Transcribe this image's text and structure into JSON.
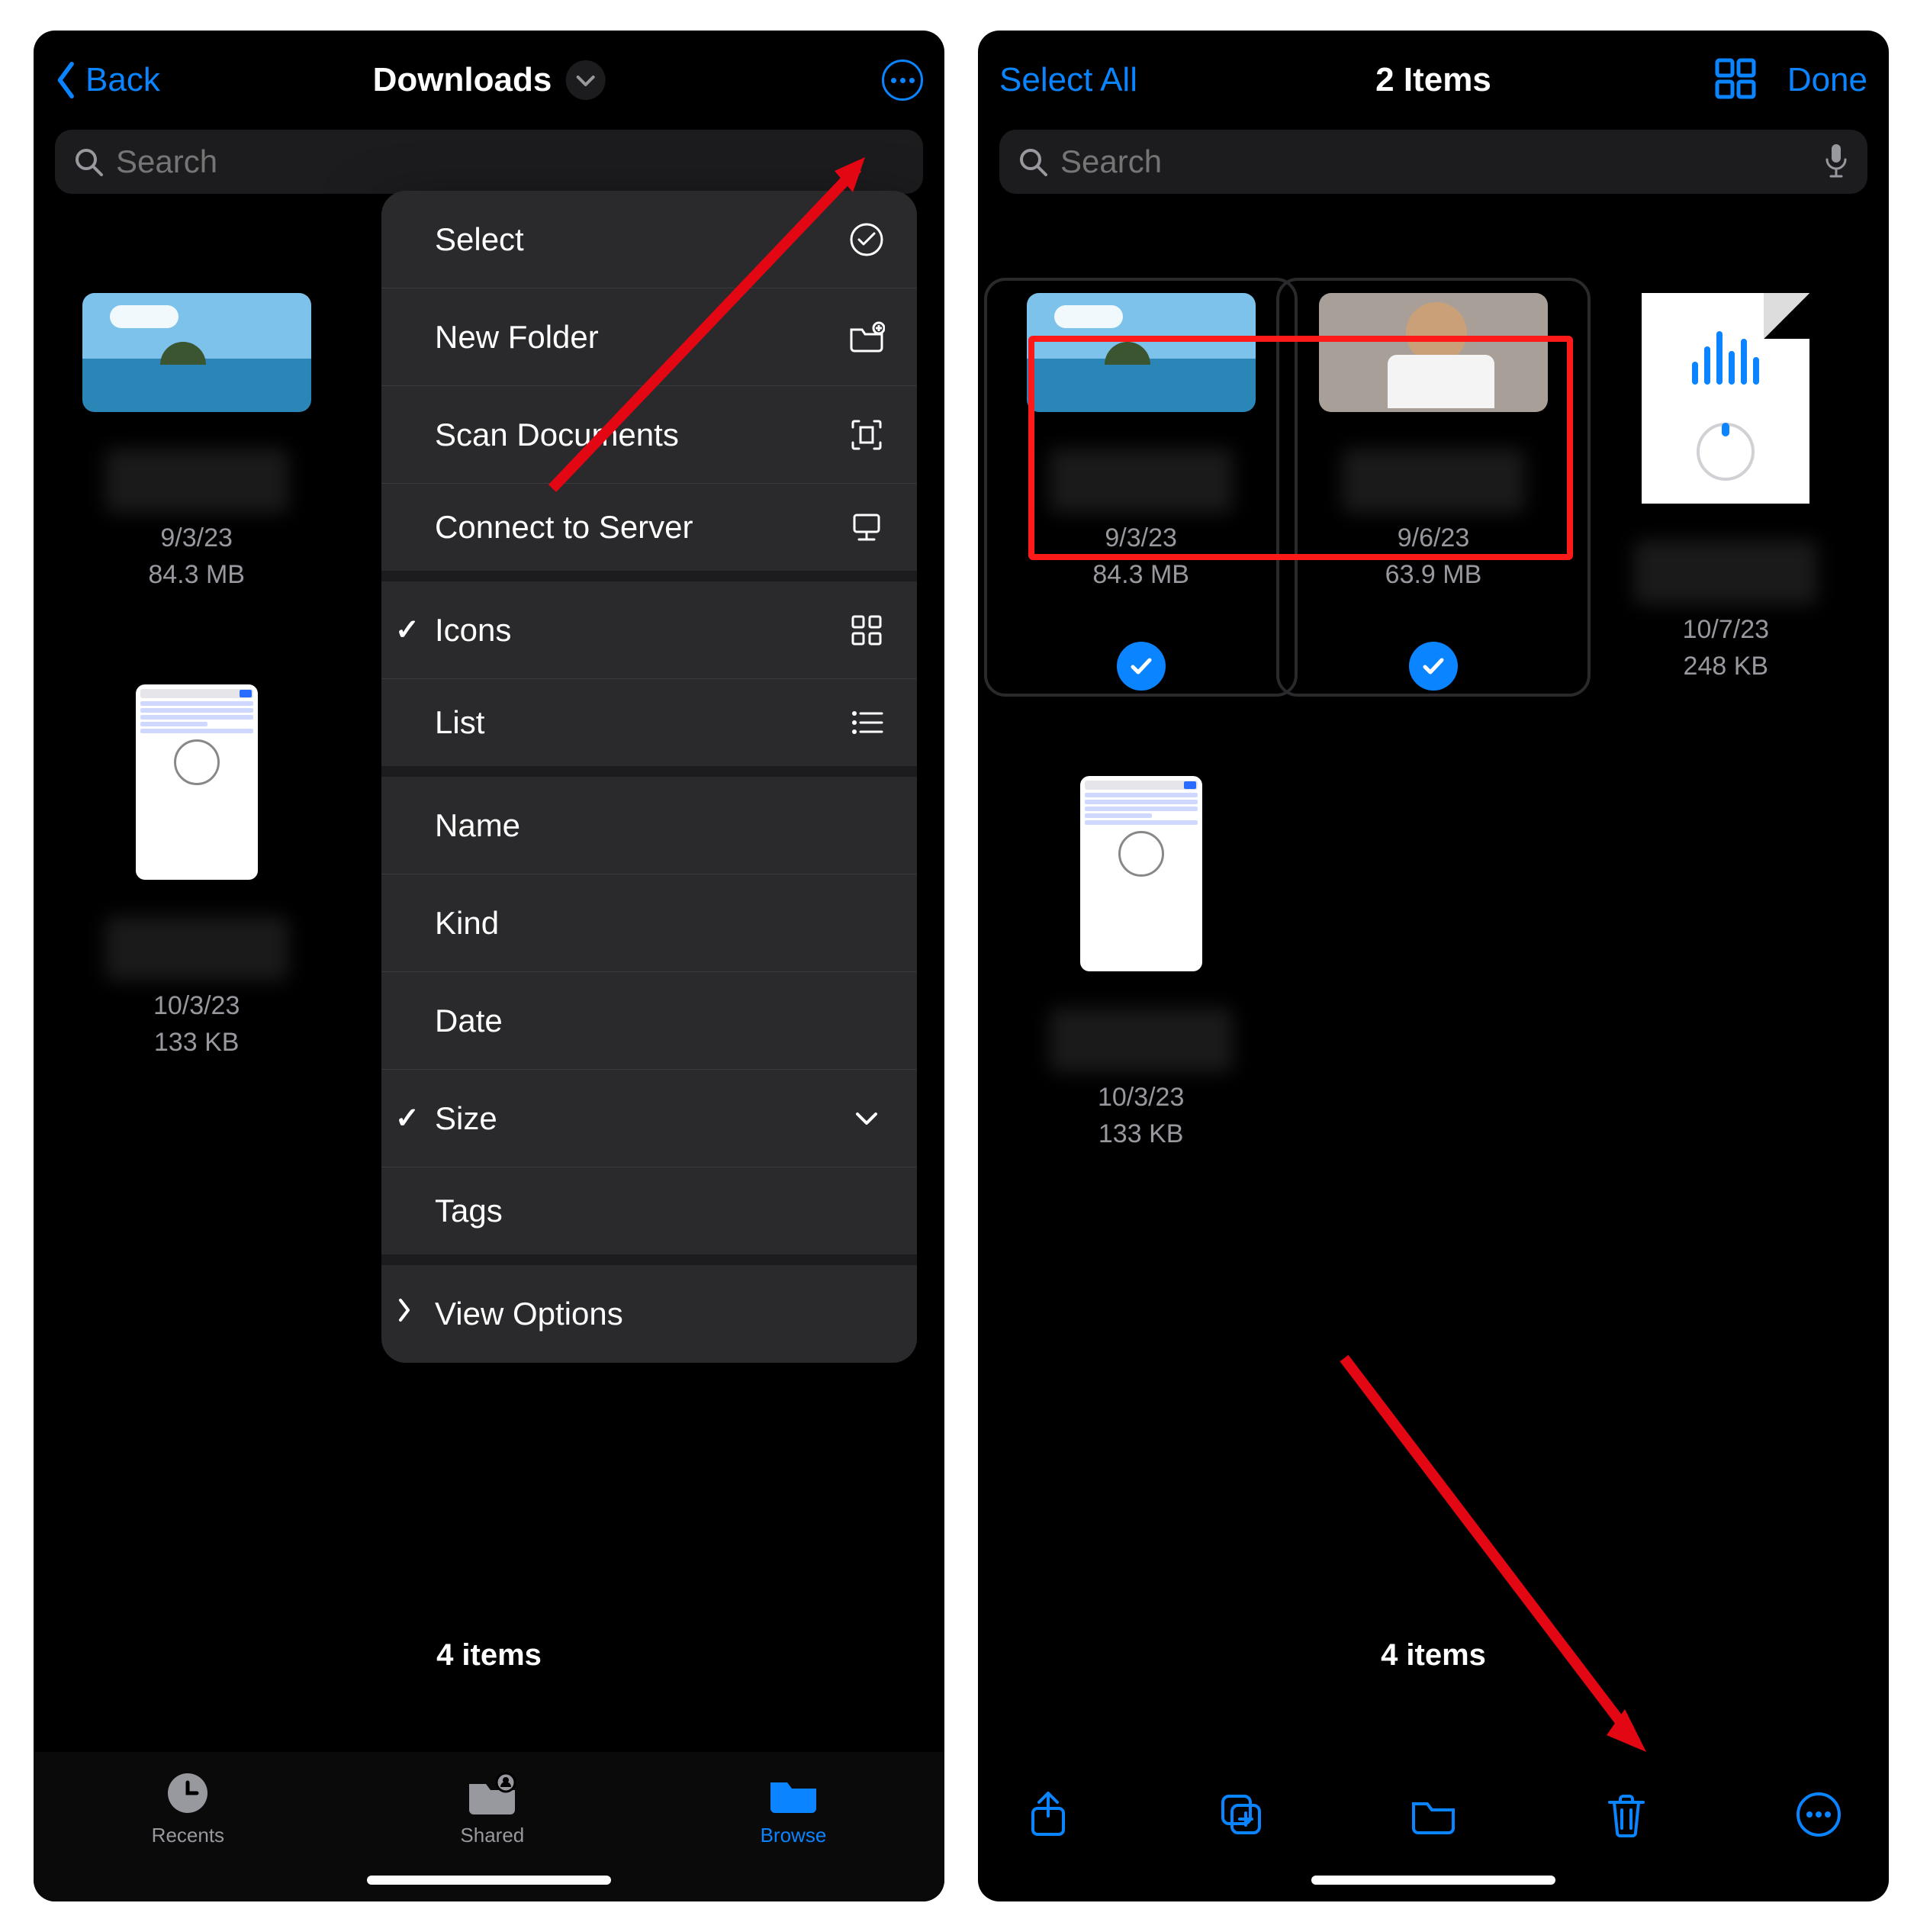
{
  "left": {
    "header": {
      "back": "Back",
      "title": "Downloads"
    },
    "search_placeholder": "Search",
    "files": [
      {
        "date": "9/3/23",
        "size": "84.3 MB"
      },
      {
        "date": "10/3/23",
        "size": "133 KB"
      }
    ],
    "menu": {
      "select": "Select",
      "new_folder": "New Folder",
      "scan_documents": "Scan Documents",
      "connect_to_server": "Connect to Server",
      "icons": "Icons",
      "list": "List",
      "name": "Name",
      "kind": "Kind",
      "date": "Date",
      "size": "Size",
      "tags": "Tags",
      "view_options": "View Options"
    },
    "footer_count": "4 items",
    "tabs": {
      "recents": "Recents",
      "shared": "Shared",
      "browse": "Browse"
    }
  },
  "right": {
    "header": {
      "select_all": "Select All",
      "title": "2 Items",
      "done": "Done"
    },
    "search_placeholder": "Search",
    "files": [
      {
        "date": "9/3/23",
        "size": "84.3 MB",
        "selected": true,
        "kind": "video"
      },
      {
        "date": "9/6/23",
        "size": "63.9 MB",
        "selected": true,
        "kind": "video"
      },
      {
        "date": "10/7/23",
        "size": "248 KB",
        "selected": false,
        "kind": "audio-doc"
      },
      {
        "date": "10/3/23",
        "size": "133 KB",
        "selected": false,
        "kind": "screenshot"
      }
    ],
    "footer_count": "4 items"
  }
}
